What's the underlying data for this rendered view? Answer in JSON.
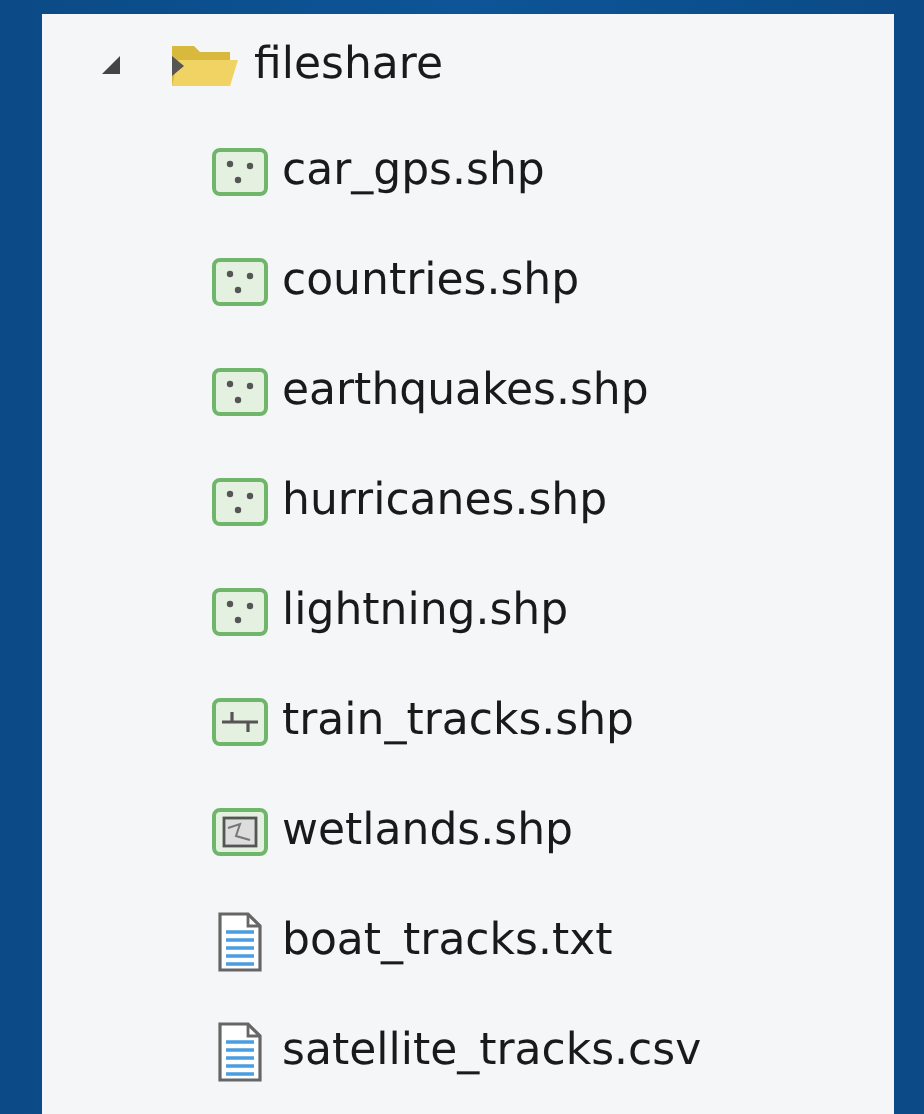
{
  "tree": {
    "label": "fileshare",
    "expanded": true,
    "children": [
      {
        "label": "car_gps.shp",
        "kind": "point"
      },
      {
        "label": "countries.shp",
        "kind": "point"
      },
      {
        "label": "earthquakes.shp",
        "kind": "point"
      },
      {
        "label": "hurricanes.shp",
        "kind": "point"
      },
      {
        "label": "lightning.shp",
        "kind": "point"
      },
      {
        "label": "train_tracks.shp",
        "kind": "line"
      },
      {
        "label": "wetlands.shp",
        "kind": "polygon"
      },
      {
        "label": "boat_tracks.txt",
        "kind": "text"
      },
      {
        "label": "satellite_tracks.csv",
        "kind": "text"
      }
    ]
  }
}
